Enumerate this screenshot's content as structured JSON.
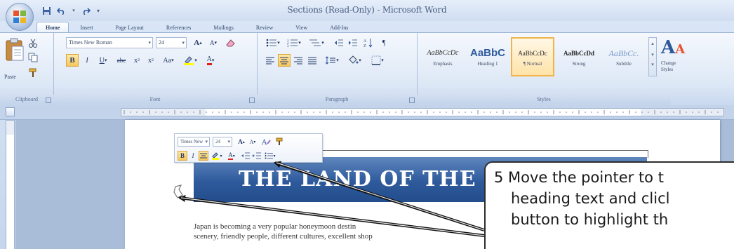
{
  "window": {
    "title": "Sections (Read-Only) - Microsoft Word"
  },
  "tabs": [
    {
      "label": "Home",
      "active": true
    },
    {
      "label": "Insert",
      "active": false
    },
    {
      "label": "Page Layout",
      "active": false
    },
    {
      "label": "References",
      "active": false
    },
    {
      "label": "Mailings",
      "active": false
    },
    {
      "label": "Review",
      "active": false
    },
    {
      "label": "View",
      "active": false
    },
    {
      "label": "Add-Ins",
      "active": false
    }
  ],
  "ribbon": {
    "clipboard": {
      "label": "Clipboard",
      "paste_label": "Paste"
    },
    "font": {
      "label": "Font",
      "font_name": "Times New Roman",
      "font_size": "24"
    },
    "paragraph": {
      "label": "Paragraph"
    },
    "styles": {
      "label": "Styles",
      "items": [
        {
          "sample": "AaBbCcDc",
          "name": "Emphasis"
        },
        {
          "sample": "AaBbC",
          "name": "Heading 1"
        },
        {
          "sample": "AaBbCcDc",
          "name": "¶ Normal"
        },
        {
          "sample": "AaBbCcDd",
          "name": "Strong"
        },
        {
          "sample": "AaBbCc.",
          "name": "Subtitle"
        }
      ],
      "change_styles_label": "Change Styles"
    }
  },
  "mini_toolbar": {
    "font_name": "Times New",
    "font_size": "24"
  },
  "document": {
    "heading": "THE LAND OF THE R",
    "body_lines": [
      "Japan is becoming a very popular honeymoon destin",
      "scenery, friendly people, different cultures, excellent shop"
    ]
  },
  "callout": {
    "line1": "5 Move the pointer to t",
    "line2": "heading text and clicl",
    "line3": "button to highlight th"
  },
  "colors": {
    "banner": "#2e5a9c",
    "selected_style_border": "#f0b44a",
    "arrow": "#111111"
  }
}
